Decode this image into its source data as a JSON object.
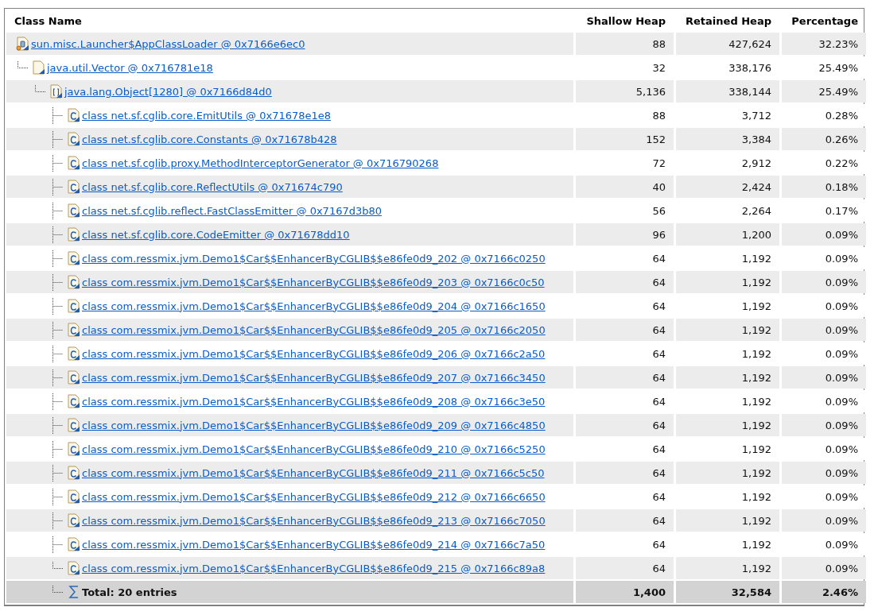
{
  "columns": [
    "Class Name",
    "Shallow Heap",
    "Retained Heap",
    "Percentage"
  ],
  "tree": [
    {
      "label": "sun.misc.Launcher$AppClassLoader @ 0x7166e6ec0",
      "kind": "loader",
      "shallow": "88",
      "retained": "427,624",
      "percentage": "32.23%",
      "children": [
        {
          "label": "java.util.Vector @ 0x716781e18",
          "kind": "object",
          "shallow": "32",
          "retained": "338,176",
          "percentage": "25.49%",
          "children": [
            {
              "label": "java.lang.Object[1280] @ 0x7166d84d0",
              "kind": "array",
              "shallow": "5,136",
              "retained": "338,144",
              "percentage": "25.49%",
              "children": [
                {
                  "label": "class net.sf.cglib.core.EmitUtils @ 0x71678e1e8",
                  "kind": "class",
                  "shallow": "88",
                  "retained": "3,712",
                  "percentage": "0.28%"
                },
                {
                  "label": "class net.sf.cglib.core.Constants @ 0x71678b428",
                  "kind": "class",
                  "shallow": "152",
                  "retained": "3,384",
                  "percentage": "0.26%"
                },
                {
                  "label": "class net.sf.cglib.proxy.MethodInterceptorGenerator @ 0x716790268",
                  "kind": "class",
                  "shallow": "72",
                  "retained": "2,912",
                  "percentage": "0.22%"
                },
                {
                  "label": "class net.sf.cglib.core.ReflectUtils @ 0x71674c790",
                  "kind": "class",
                  "shallow": "40",
                  "retained": "2,424",
                  "percentage": "0.18%"
                },
                {
                  "label": "class net.sf.cglib.reflect.FastClassEmitter @ 0x7167d3b80",
                  "kind": "class",
                  "shallow": "56",
                  "retained": "2,264",
                  "percentage": "0.17%"
                },
                {
                  "label": "class net.sf.cglib.core.CodeEmitter @ 0x71678dd10",
                  "kind": "class",
                  "shallow": "96",
                  "retained": "1,200",
                  "percentage": "0.09%"
                },
                {
                  "label": "class com.ressmix.jvm.Demo1$Car$$EnhancerByCGLIB$$e86fe0d9_202 @ 0x7166c0250",
                  "kind": "class",
                  "shallow": "64",
                  "retained": "1,192",
                  "percentage": "0.09%"
                },
                {
                  "label": "class com.ressmix.jvm.Demo1$Car$$EnhancerByCGLIB$$e86fe0d9_203 @ 0x7166c0c50",
                  "kind": "class",
                  "shallow": "64",
                  "retained": "1,192",
                  "percentage": "0.09%"
                },
                {
                  "label": "class com.ressmix.jvm.Demo1$Car$$EnhancerByCGLIB$$e86fe0d9_204 @ 0x7166c1650",
                  "kind": "class",
                  "shallow": "64",
                  "retained": "1,192",
                  "percentage": "0.09%"
                },
                {
                  "label": "class com.ressmix.jvm.Demo1$Car$$EnhancerByCGLIB$$e86fe0d9_205 @ 0x7166c2050",
                  "kind": "class",
                  "shallow": "64",
                  "retained": "1,192",
                  "percentage": "0.09%"
                },
                {
                  "label": "class com.ressmix.jvm.Demo1$Car$$EnhancerByCGLIB$$e86fe0d9_206 @ 0x7166c2a50",
                  "kind": "class",
                  "shallow": "64",
                  "retained": "1,192",
                  "percentage": "0.09%"
                },
                {
                  "label": "class com.ressmix.jvm.Demo1$Car$$EnhancerByCGLIB$$e86fe0d9_207 @ 0x7166c3450",
                  "kind": "class",
                  "shallow": "64",
                  "retained": "1,192",
                  "percentage": "0.09%"
                },
                {
                  "label": "class com.ressmix.jvm.Demo1$Car$$EnhancerByCGLIB$$e86fe0d9_208 @ 0x7166c3e50",
                  "kind": "class",
                  "shallow": "64",
                  "retained": "1,192",
                  "percentage": "0.09%"
                },
                {
                  "label": "class com.ressmix.jvm.Demo1$Car$$EnhancerByCGLIB$$e86fe0d9_209 @ 0x7166c4850",
                  "kind": "class",
                  "shallow": "64",
                  "retained": "1,192",
                  "percentage": "0.09%"
                },
                {
                  "label": "class com.ressmix.jvm.Demo1$Car$$EnhancerByCGLIB$$e86fe0d9_210 @ 0x7166c5250",
                  "kind": "class",
                  "shallow": "64",
                  "retained": "1,192",
                  "percentage": "0.09%"
                },
                {
                  "label": "class com.ressmix.jvm.Demo1$Car$$EnhancerByCGLIB$$e86fe0d9_211 @ 0x7166c5c50",
                  "kind": "class",
                  "shallow": "64",
                  "retained": "1,192",
                  "percentage": "0.09%"
                },
                {
                  "label": "class com.ressmix.jvm.Demo1$Car$$EnhancerByCGLIB$$e86fe0d9_212 @ 0x7166c6650",
                  "kind": "class",
                  "shallow": "64",
                  "retained": "1,192",
                  "percentage": "0.09%"
                },
                {
                  "label": "class com.ressmix.jvm.Demo1$Car$$EnhancerByCGLIB$$e86fe0d9_213 @ 0x7166c7050",
                  "kind": "class",
                  "shallow": "64",
                  "retained": "1,192",
                  "percentage": "0.09%"
                },
                {
                  "label": "class com.ressmix.jvm.Demo1$Car$$EnhancerByCGLIB$$e86fe0d9_214 @ 0x7166c7a50",
                  "kind": "class",
                  "shallow": "64",
                  "retained": "1,192",
                  "percentage": "0.09%"
                },
                {
                  "label": "class com.ressmix.jvm.Demo1$Car$$EnhancerByCGLIB$$e86fe0d9_215 @ 0x7166c89a8",
                  "kind": "class",
                  "shallow": "64",
                  "retained": "1,192",
                  "percentage": "0.09%"
                }
              ]
            }
          ]
        }
      ]
    }
  ],
  "total": {
    "label": "Total: 20 entries",
    "shallow": "1,400",
    "retained": "32,584",
    "percentage": "2.46%"
  }
}
